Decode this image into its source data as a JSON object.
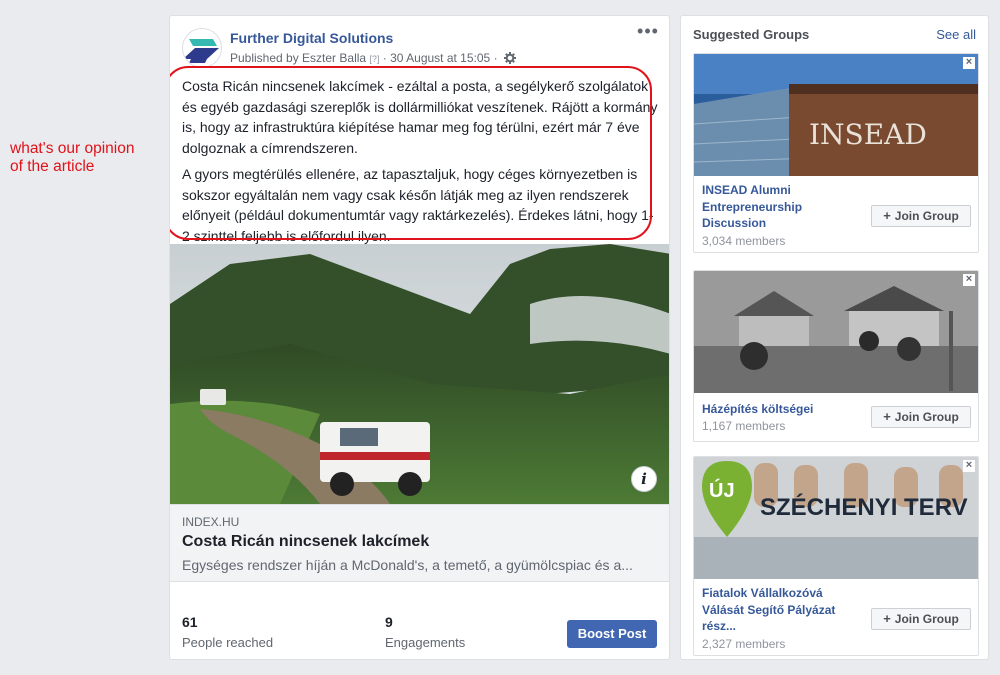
{
  "annotation": {
    "line1": "what's our opinion",
    "line2": "of the article"
  },
  "post": {
    "page_name": "Further Digital Solutions",
    "published_by": "Published by Eszter Balla",
    "help_marker": "[?]",
    "separator": "·",
    "timestamp": "30 August at 15:05",
    "more_label": "•••",
    "text_p1": "Costa Ricán nincsenek lakcímek - ezáltal a posta, a segélykerő szolgálatok és egyéb gazdasági szereplők is dollármilliókat veszítenek. Rájött a kormány is, hogy az infrastruktúra kiépítése hamar meg fog térülni, ezért már 7 éve dolgoznak a címrendszeren.",
    "text_p2": "A gyors megtérülés ellenére, az tapasztaljuk, hogy céges környezetben is sokszor egyáltalán nem vagy csak későn látják meg az ilyen rendszerek előnyeit (például dokumentumtár vagy raktárkezelés). Érdekes látni, hogy 1-2 szinttel feljebb is előfordul ilyen.",
    "info_label": "i",
    "link": {
      "domain": "INDEX.HU",
      "title": "Costa Ricán nincsenek lakcímek",
      "description": "Egységes rendszer híján a McDonald's, a temető, a gyümölcspiac és a..."
    },
    "stats": [
      {
        "value": "61",
        "label": "People reached"
      },
      {
        "value": "9",
        "label": "Engagements"
      }
    ],
    "boost_label": "Boost Post"
  },
  "suggested_groups": {
    "title": "Suggested Groups",
    "see_all": "See all",
    "join_label": "Join Group",
    "close_label": "×",
    "groups": [
      {
        "name": "INSEAD Alumni Entrepreneurship Discussion",
        "members": "3,034 members",
        "image_text": "INSEAD"
      },
      {
        "name": "Házépítés költségei",
        "members": "1,167 members"
      },
      {
        "name": "Fiatalok Vállalkozóvá Válását Segítő Pályázat rész...",
        "members": "2,327 members",
        "image_badge": "ÚJ",
        "image_text": "SZÉCHENYI TERV"
      }
    ]
  },
  "colors": {
    "link_blue": "#365899",
    "boost_blue": "#4267b2",
    "annotation_red": "#e0131a"
  }
}
